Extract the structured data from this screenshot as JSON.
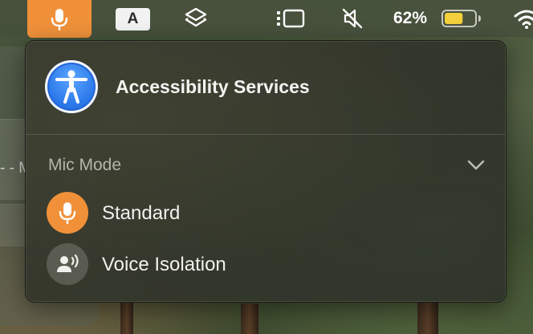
{
  "menubar": {
    "input_source": "A",
    "battery_percent": "62%",
    "battery_level": 0.62,
    "accent_color": "#f0913a"
  },
  "background_window": {
    "partial_text": "- - M"
  },
  "panel": {
    "title": "Accessibility Services",
    "section_label": "Mic Mode",
    "options": [
      {
        "label": "Standard",
        "icon": "microphone-icon",
        "selected": true
      },
      {
        "label": "Voice Isolation",
        "icon": "voice-isolation-icon",
        "selected": false
      }
    ]
  }
}
